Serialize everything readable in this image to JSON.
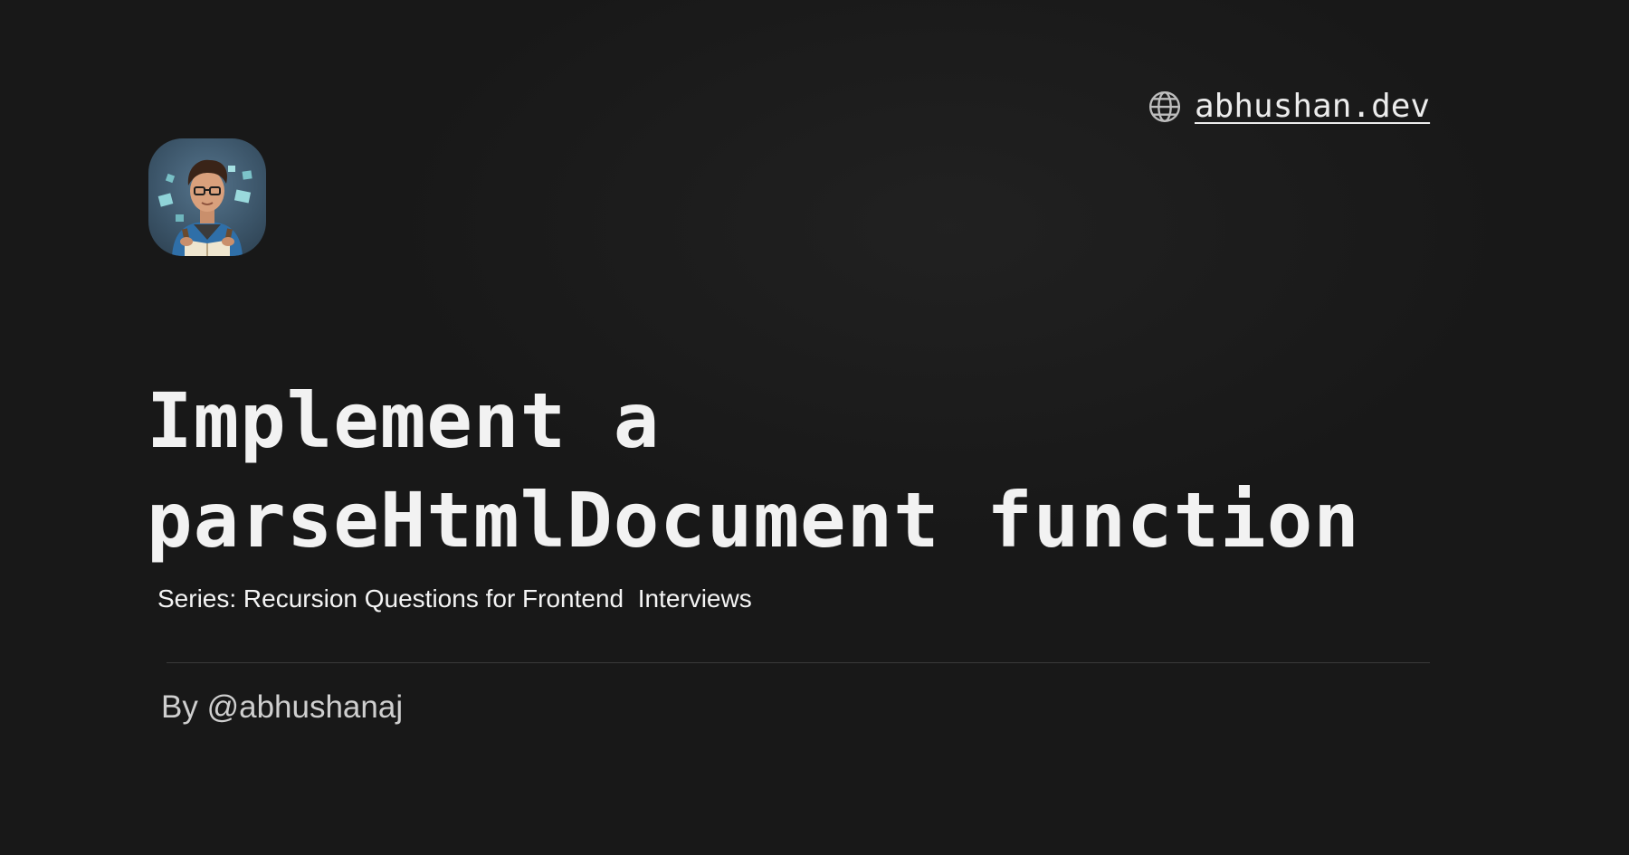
{
  "header": {
    "site_link": "abhushan.dev",
    "site_icon": "globe-icon"
  },
  "avatar": {
    "icon": "avatar-illustration"
  },
  "title": {
    "line1": "Implement a",
    "line2": "parseHtmlDocument function"
  },
  "series": {
    "text": "Series: Recursion Questions for Frontend  Interviews"
  },
  "byline": {
    "text": "By @abhushanaj"
  },
  "colors": {
    "background": "#181818",
    "text": "#f2f2f2",
    "muted": "#cfcfcf",
    "divider": "#3a3a3a"
  }
}
